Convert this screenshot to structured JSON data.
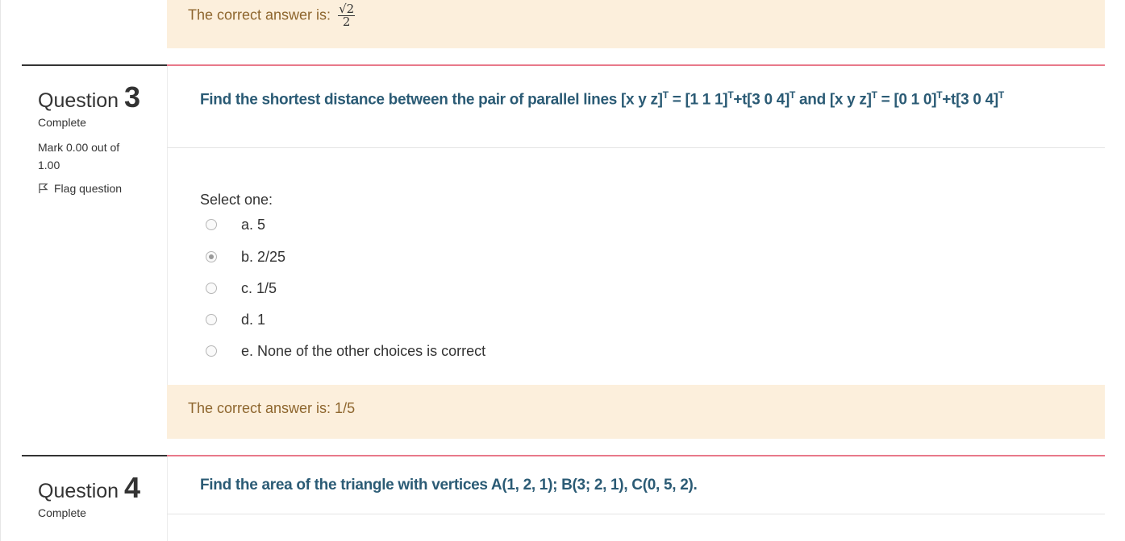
{
  "prev_feedback": {
    "label": "The correct answer is:",
    "frac_num": "√2",
    "frac_den": "2"
  },
  "q3": {
    "prefix": "Question",
    "number": "3",
    "state": "Complete",
    "grade": "Mark 0.00 out of 1.00",
    "flag_label": "Flag question",
    "text_parts": [
      "Find the shortest distance between the pair of parallel lines [x  y  z]",
      "T",
      " = [1  1  1]",
      "T",
      "+t[3  0  4]",
      "T",
      " and  [x  y  z]",
      "T",
      " = [0  1  0]",
      "T",
      "+t[3  0  4]",
      "T"
    ],
    "select_label": "Select one:",
    "options": [
      {
        "label": "a. 5",
        "checked": false
      },
      {
        "label": "b. 2/25",
        "checked": true
      },
      {
        "label": "c. 1/5",
        "checked": false
      },
      {
        "label": "d. 1",
        "checked": false
      },
      {
        "label": "e. None of the other choices is correct",
        "checked": false
      }
    ],
    "feedback": "The correct answer is: 1/5"
  },
  "q4": {
    "prefix": "Question",
    "number": "4",
    "state": "Complete",
    "text": "Find the area of the triangle with vertices A(1, 2, 1); B(3; 2, 1), C(0, 5, 2)."
  }
}
